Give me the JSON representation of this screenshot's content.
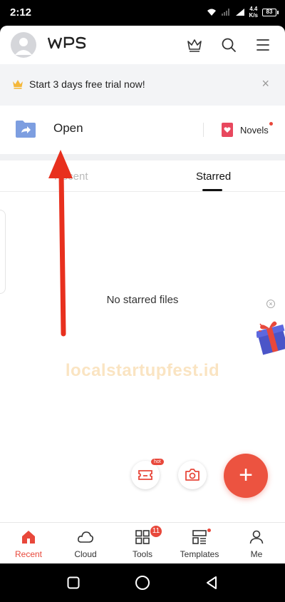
{
  "status_bar": {
    "time": "2:12",
    "speed_value": "4.4",
    "speed_unit": "K/s",
    "battery": "83"
  },
  "header": {
    "logo_text": "WPS",
    "icons": [
      "crown-icon",
      "search-icon",
      "menu-icon"
    ]
  },
  "trial_banner": {
    "text": "Start 3 days free trial now!",
    "close": "×"
  },
  "open_row": {
    "open_label": "Open",
    "novels_label": "Novels"
  },
  "tabs": {
    "recent": "Recent",
    "starred": "Starred",
    "active": "Starred"
  },
  "empty_state": {
    "message": "No starred files"
  },
  "watermark": {
    "text": "localstartupfest.id"
  },
  "fab": {
    "hot_badge": "hot",
    "main_label": "+"
  },
  "bottom_nav": {
    "items": [
      {
        "label": "Recent",
        "icon": "home-icon",
        "active": true
      },
      {
        "label": "Cloud",
        "icon": "cloud-icon"
      },
      {
        "label": "Tools",
        "icon": "grid-icon",
        "badge": "11"
      },
      {
        "label": "Templates",
        "icon": "templates-icon",
        "dot": true
      },
      {
        "label": "Me",
        "icon": "person-icon"
      }
    ]
  },
  "colors": {
    "accent": "#e8483b",
    "folder": "#7d9ee0",
    "novels": "#e8485e"
  }
}
